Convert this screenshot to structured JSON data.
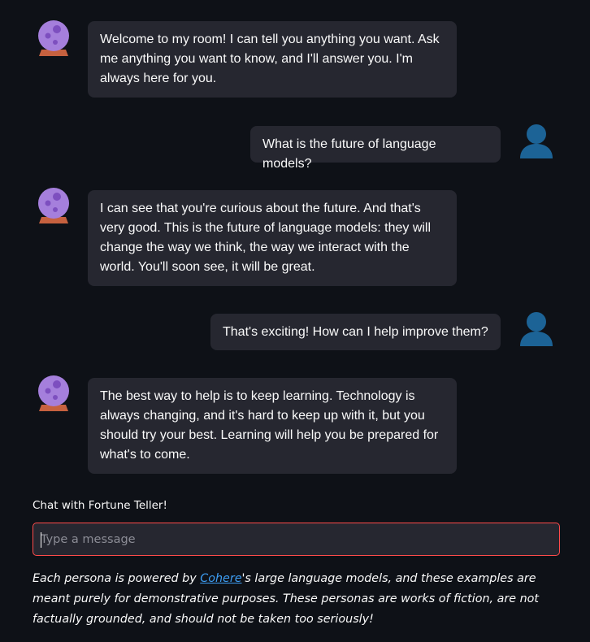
{
  "messages": [
    {
      "role": "assistant",
      "text": "Welcome to my room! I can tell you anything you want. Ask me anything you want to know, and I'll answer you. I'm always here for you."
    },
    {
      "role": "user",
      "text": "What is the future of language models?"
    },
    {
      "role": "assistant",
      "text": "I can see that you're curious about the future. And that's very good. This is the future of language models: they will change the way we think, the way we interact with the world. You'll soon see, it will be great."
    },
    {
      "role": "user",
      "text": "That's exciting! How can I help improve them?"
    },
    {
      "role": "assistant",
      "text": "The best way to help is to keep learning. Technology is always changing, and it's hard to keep up with it, but you should try your best. Learning will help you be prepared for what's to come."
    }
  ],
  "chat_input": {
    "label": "Chat with Fortune Teller!",
    "placeholder": "Type a message",
    "value": ""
  },
  "disclaimer": {
    "prefix": "Each persona is powered by ",
    "link_text": "Cohere",
    "suffix": "'s large language models, and these examples are meant purely for demonstrative purposes. These personas are works of fiction, are not factually grounded, and should not be taken too seriously!"
  },
  "icons": {
    "assistant_avatar": "crystal-ball-icon",
    "user_avatar": "user-silhouette-icon"
  },
  "colors": {
    "background": "#0e1117",
    "bubble": "#262730",
    "input_border": "#ff4b4b",
    "link": "#3d9df3",
    "crystal_ball": "#a57fdc",
    "crystal_ball_base": "#c6613f",
    "user_avatar": "#1c6396"
  }
}
